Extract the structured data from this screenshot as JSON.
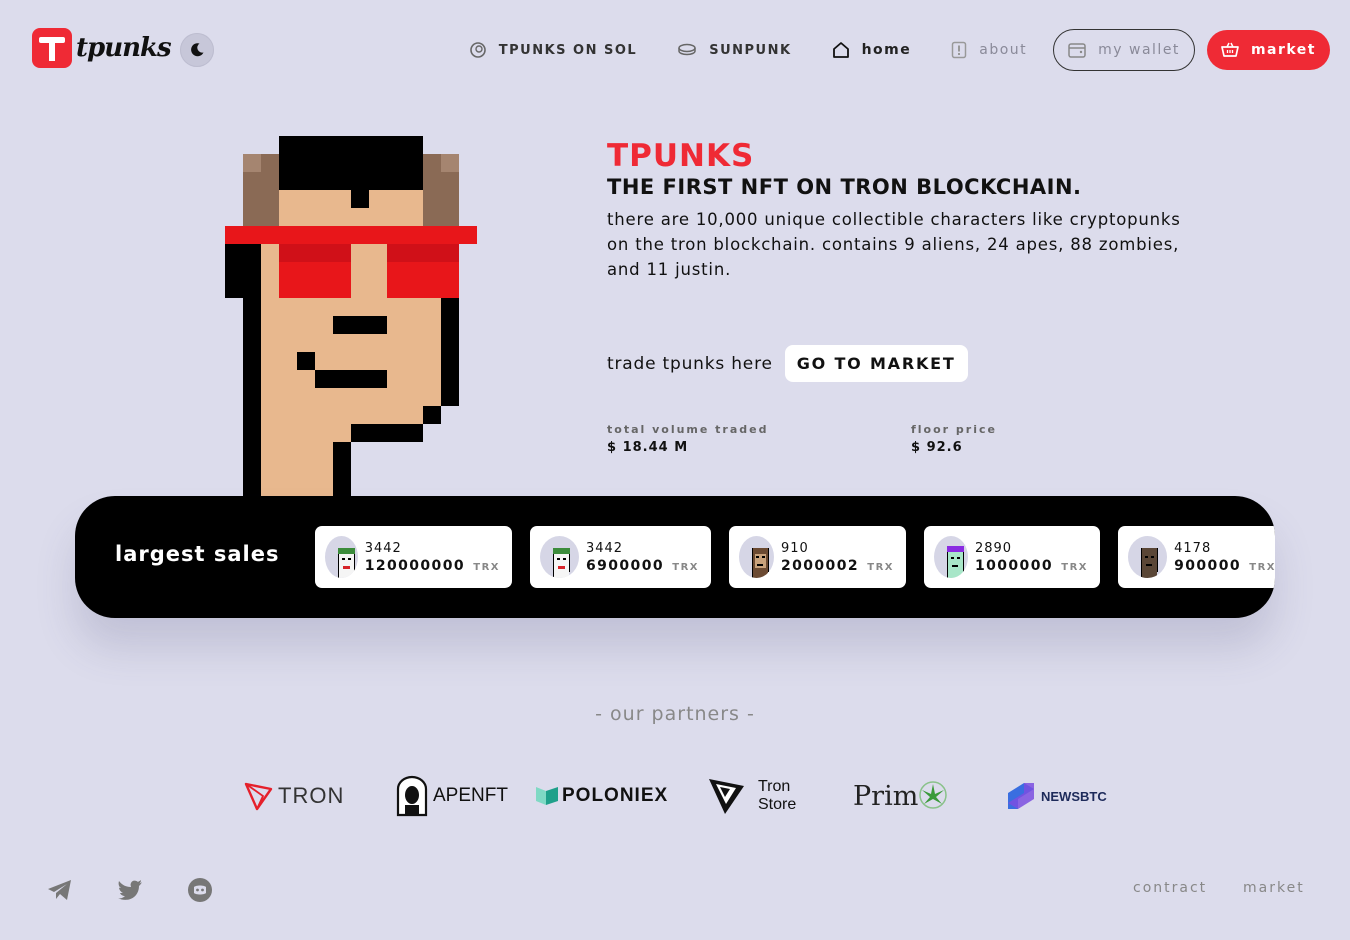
{
  "brand": {
    "name": "tpunks"
  },
  "nav": {
    "items": [
      {
        "label": "TPUNKS ON SOL",
        "icon": "coin-icon"
      },
      {
        "label": "SUNPUNK",
        "icon": "coins-stack-icon"
      },
      {
        "label": "home",
        "icon": "home-icon"
      },
      {
        "label": "about",
        "icon": "info-icon"
      }
    ],
    "wallet_label": "my wallet",
    "market_label": "market"
  },
  "hero": {
    "title": "TPUNKS",
    "subtitle": "THE FIRST NFT ON TRON BLOCKCHAIN.",
    "description": "there are 10,000 unique collectible characters like cryptopunks on the tron blockchain. contains 9 aliens, 24 apes, 88 zombies, and 11 justin.",
    "trade_label": "trade tpunks here",
    "cta_label": "GO TO MARKET",
    "stats": {
      "volume_label": "total volume traded",
      "volume_value": "$ 18.44 M",
      "floor_label": "floor price",
      "floor_value": "$ 92.6"
    }
  },
  "sales": {
    "title": "largest sales",
    "items": [
      {
        "id": "3442",
        "price": "120000000",
        "currency": "TRX",
        "type": "clown"
      },
      {
        "id": "3442",
        "price": "6900000",
        "currency": "TRX",
        "type": "clown"
      },
      {
        "id": "910",
        "price": "2000002",
        "currency": "TRX",
        "type": "ape"
      },
      {
        "id": "2890",
        "price": "1000000",
        "currency": "TRX",
        "type": "zombie"
      },
      {
        "id": "4178",
        "price": "900000",
        "currency": "TRX",
        "type": "dark"
      }
    ]
  },
  "partners": {
    "title": "- our partners -",
    "items": [
      {
        "name": "TRON"
      },
      {
        "name": "APENFT"
      },
      {
        "name": "POLONIEX"
      },
      {
        "name_line1": "Tron",
        "name_line2": "Store"
      },
      {
        "name": "Prim"
      },
      {
        "name": "NEWSBTC"
      }
    ]
  },
  "footer": {
    "social": [
      "telegram-icon",
      "twitter-icon",
      "discord-icon"
    ],
    "links": [
      "contract",
      "market"
    ]
  },
  "colors": {
    "accent": "#ef2a35",
    "background": "#dcdcec",
    "strip": "#000000"
  }
}
